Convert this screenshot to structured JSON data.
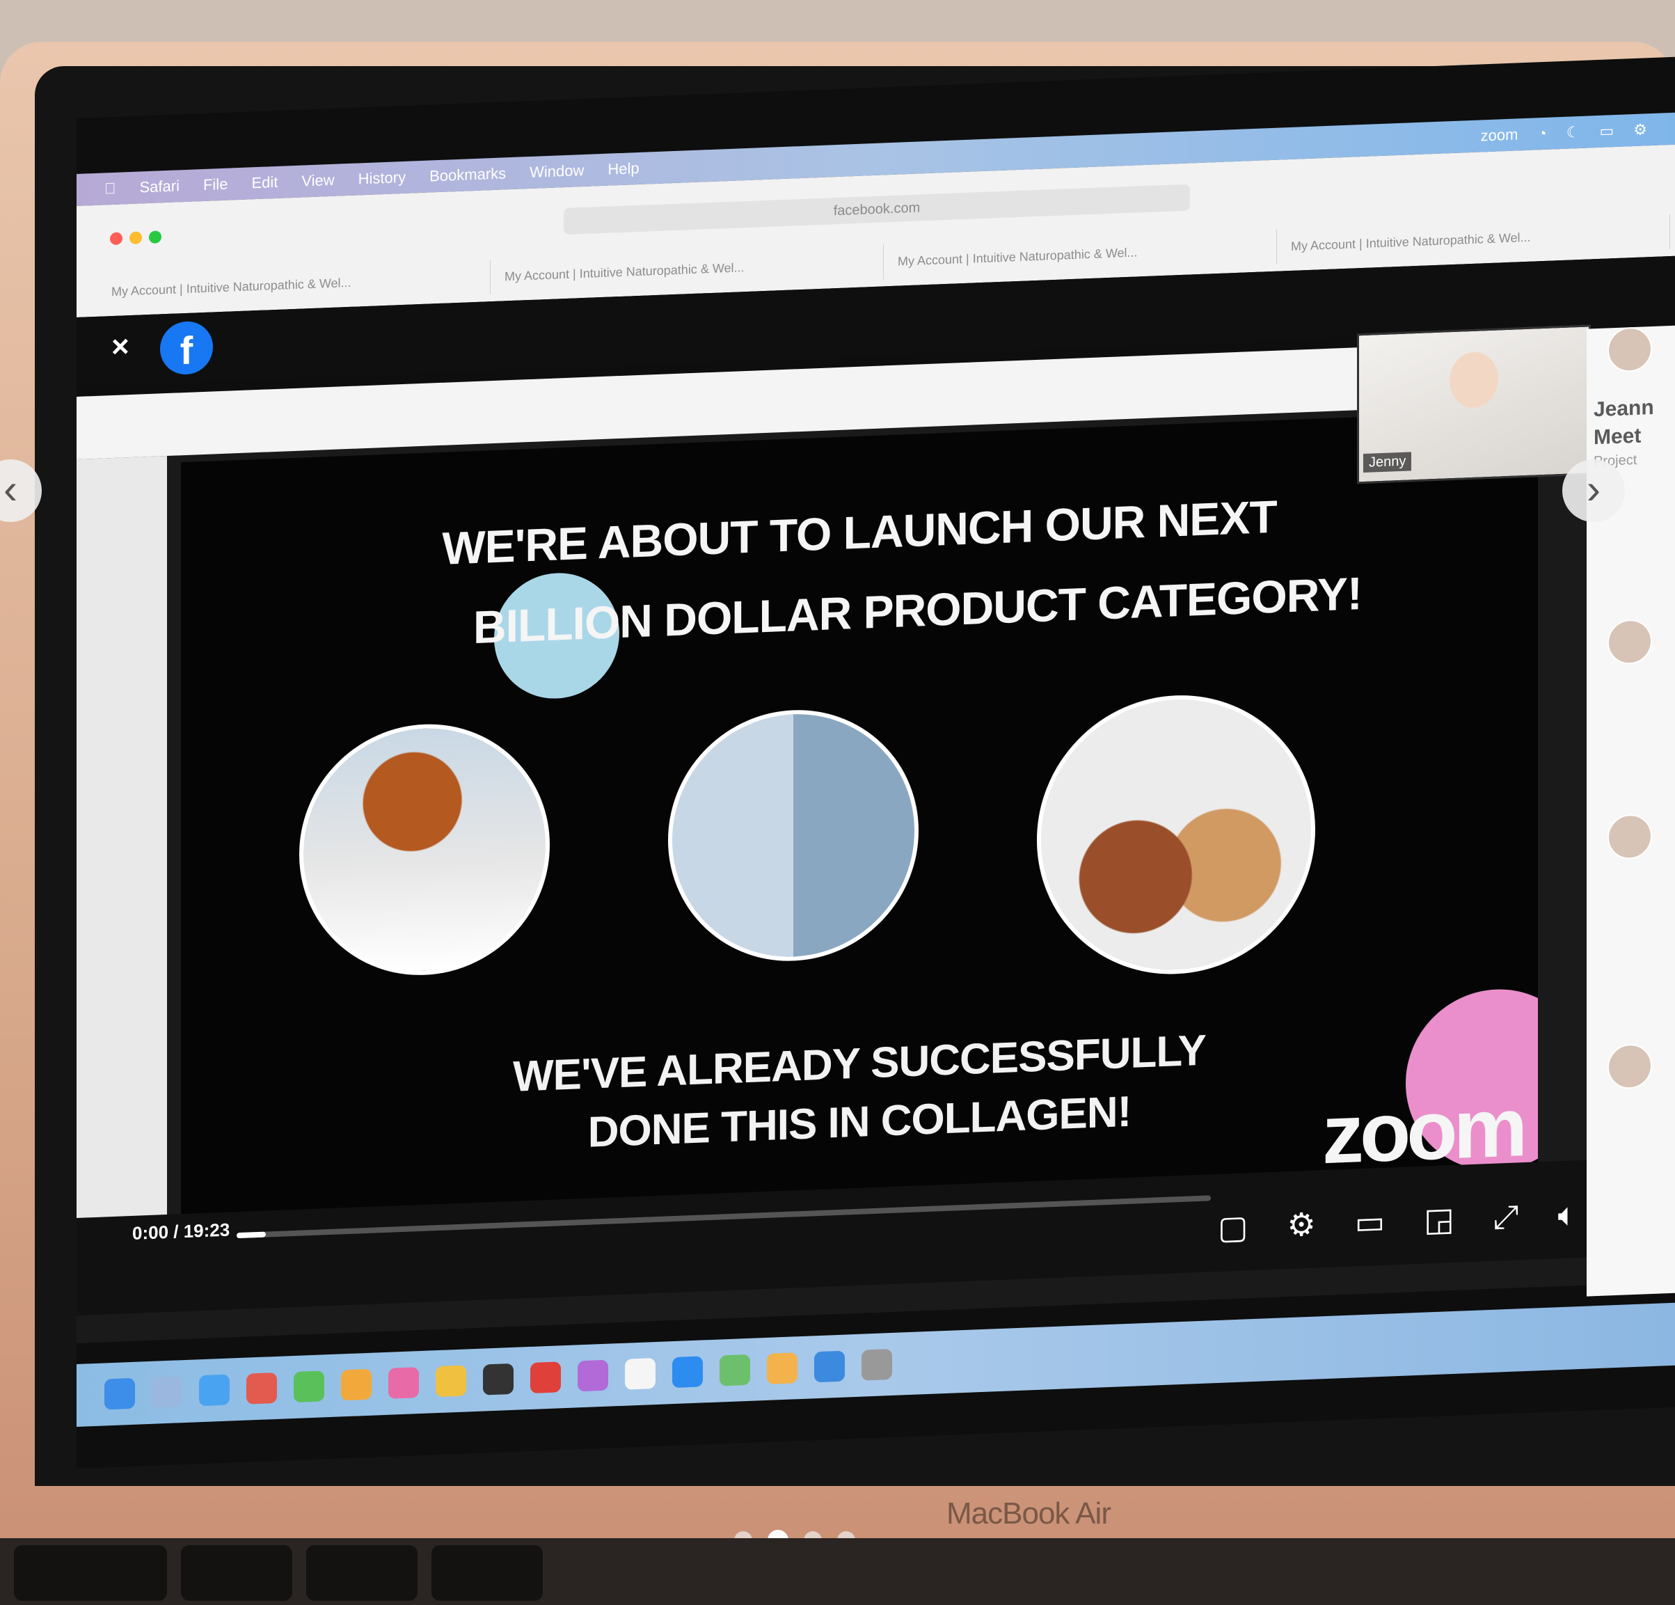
{
  "menubar": {
    "items": [
      "Safari",
      "File",
      "Edit",
      "View",
      "History",
      "Bookmarks",
      "Window",
      "Help"
    ],
    "status_app": "zoom"
  },
  "browser": {
    "url": "facebook.com",
    "tabs": [
      "My Account | Intuitive Naturopathic & Wel...",
      "My Account | Intuitive Naturopathic & Wel...",
      "My Account | Intuitive Naturopathic & Wel...",
      "My Account | Intuitive Naturopathic & Wel..."
    ]
  },
  "viewer": {
    "close_icon": "×",
    "fb_logo": "f"
  },
  "slide": {
    "line1": "WE'RE ABOUT TO LAUNCH OUR NEXT",
    "line2": "BILLION DOLLAR PRODUCT CATEGORY!",
    "line3": "WE'VE ALREADY SUCCESSFULLY",
    "line4": "DONE THIS IN COLLAGEN!",
    "zoom_logo": "zoom",
    "presenter_label": "Jenny"
  },
  "video": {
    "time": "0:00 / 19:23",
    "progress": 0.03
  },
  "sidebar": {
    "name_partial": "Jeann",
    "meet_partial": "Meet",
    "sub_partial": "Project"
  },
  "laptop": {
    "model_label": "MacBook Air"
  },
  "carousel": {
    "dots": 4,
    "active_index": 1
  },
  "colors": {
    "accent_blue": "#aad7e8",
    "accent_pink": "#ea8fcb",
    "facebook": "#1877f2"
  }
}
